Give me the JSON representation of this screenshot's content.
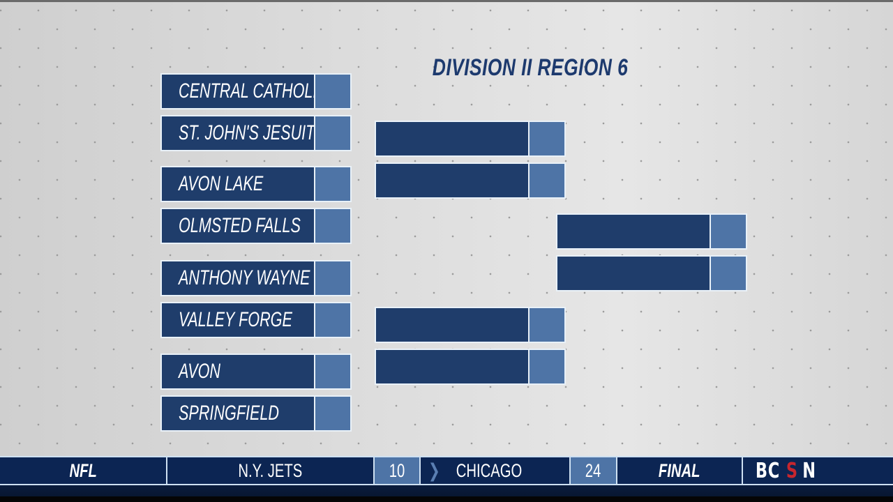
{
  "bracket": {
    "title": "DIVISION II REGION 6",
    "round1": [
      {
        "team": "CENTRAL CATHOLIC",
        "score": ""
      },
      {
        "team": "ST. JOHN'S JESUIT",
        "score": ""
      },
      {
        "team": "AVON LAKE",
        "score": ""
      },
      {
        "team": "OLMSTED FALLS",
        "score": ""
      },
      {
        "team": "ANTHONY WAYNE",
        "score": ""
      },
      {
        "team": "VALLEY FORGE",
        "score": ""
      },
      {
        "team": "AVON",
        "score": ""
      },
      {
        "team": "SPRINGFIELD",
        "score": ""
      }
    ],
    "round2": [
      {
        "team": "",
        "score": ""
      },
      {
        "team": "",
        "score": ""
      },
      {
        "team": "",
        "score": ""
      },
      {
        "team": "",
        "score": ""
      }
    ],
    "round3": [
      {
        "team": "",
        "score": ""
      },
      {
        "team": "",
        "score": ""
      }
    ]
  },
  "ticker": {
    "league": "NFL",
    "away_team": "N.Y. JETS",
    "away_score": "10",
    "home_team": "CHICAGO",
    "home_score": "24",
    "status": "FINAL",
    "network_logo": {
      "part1": "BC",
      "part2": "S",
      "part3": "N"
    },
    "winner_indicator_icon": "chevron-right-icon"
  },
  "colors": {
    "slot_dark": "#1f3d6b",
    "slot_seed": "#4e74a6",
    "title": "#1d3a6e",
    "ticker_bg": "#0c2553",
    "logo_red": "#c8262e"
  }
}
